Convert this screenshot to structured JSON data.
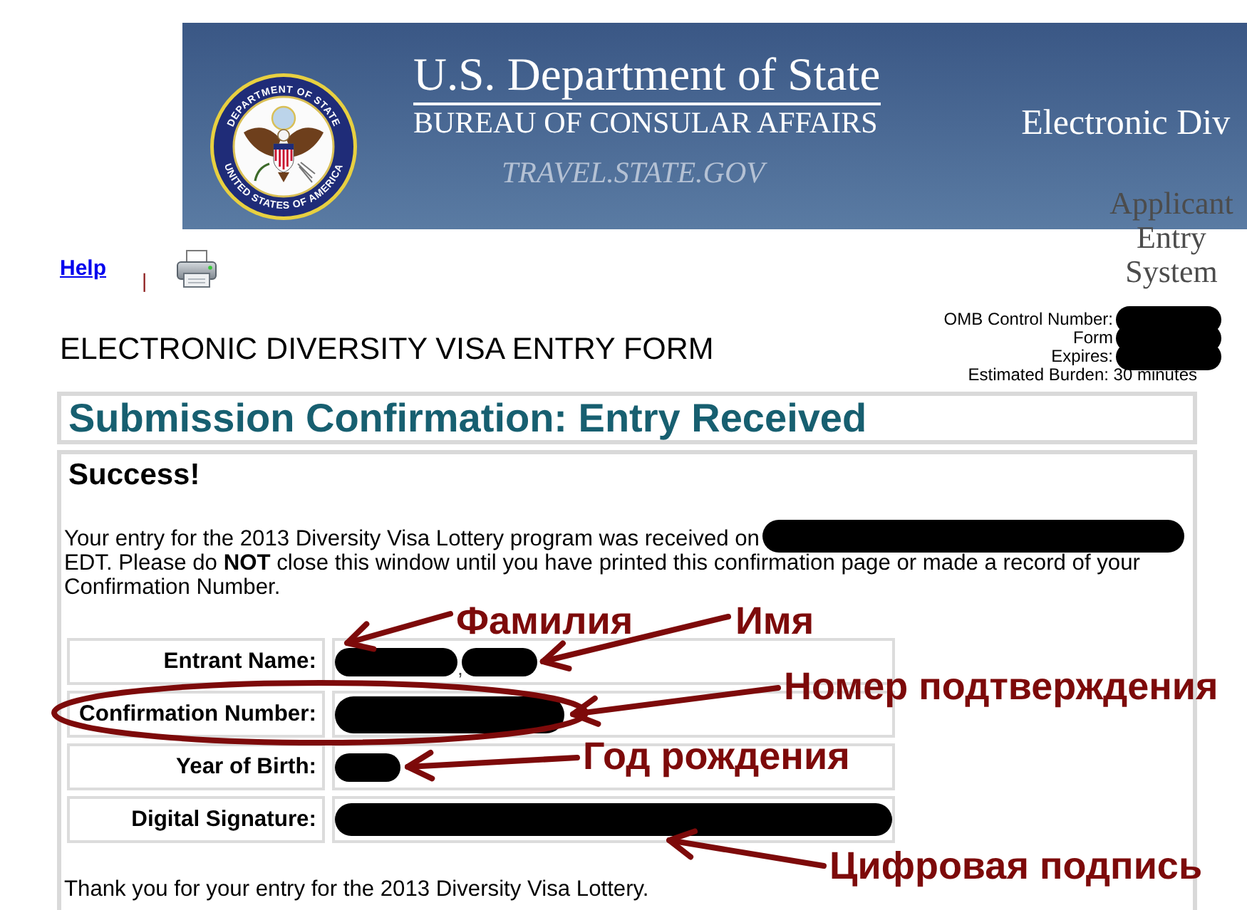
{
  "banner": {
    "seal": {
      "top_text": "DEPARTMENT OF STATE",
      "bottom_text": "UNITED STATES OF AMERICA"
    },
    "title": "U.S. Department of State",
    "subtitle": "BUREAU OF CONSULAR AFFAIRS",
    "site": "TRAVEL.STATE.GOV",
    "system_title": "Electronic Div"
  },
  "side_title": "Applicant Entry System",
  "toolbar": {
    "help_link": "Help",
    "separator": "|"
  },
  "omb": [
    {
      "label": "OMB Control Number:",
      "redacted": true
    },
    {
      "label": "Form",
      "redacted": true
    },
    {
      "label": "Expires:",
      "redacted": true
    },
    {
      "label": "Estimated Burden: 30 minutes",
      "redacted": false
    }
  ],
  "form_title": "ELECTRONIC DIVERSITY VISA ENTRY FORM",
  "heading": "Submission Confirmation: Entry Received",
  "success": "Success!",
  "message": {
    "text_before": "Your entry for the 2013 Diversity Visa Lottery program was received on",
    "date_redacted": true,
    "text_after": "EDT. Please do **NOT** close this window until you have printed this confirmation page or made a record of your Confirmation Number."
  },
  "fields": [
    {
      "label": "Entrant Name:",
      "circled": false,
      "value": [
        {
          "kind": "redacted",
          "note": "Фамилия"
        },
        {
          "kind": "text",
          "text": ","
        },
        {
          "kind": "redacted",
          "note": "Имя"
        }
      ]
    },
    {
      "label": "Confirmation Number:",
      "circled": true,
      "value": [
        {
          "kind": "redacted",
          "note": "Номер подтверждения"
        }
      ]
    },
    {
      "label": "Year of Birth:",
      "circled": false,
      "value": [
        {
          "kind": "redacted",
          "note": "Год рождения"
        }
      ]
    },
    {
      "label": "Digital Signature:",
      "circled": false,
      "value": [
        {
          "kind": "redacted",
          "note": "Цифровая подпись"
        }
      ]
    }
  ],
  "closing": "Thank you for your entry for the 2013 Diversity Visa Lottery."
}
